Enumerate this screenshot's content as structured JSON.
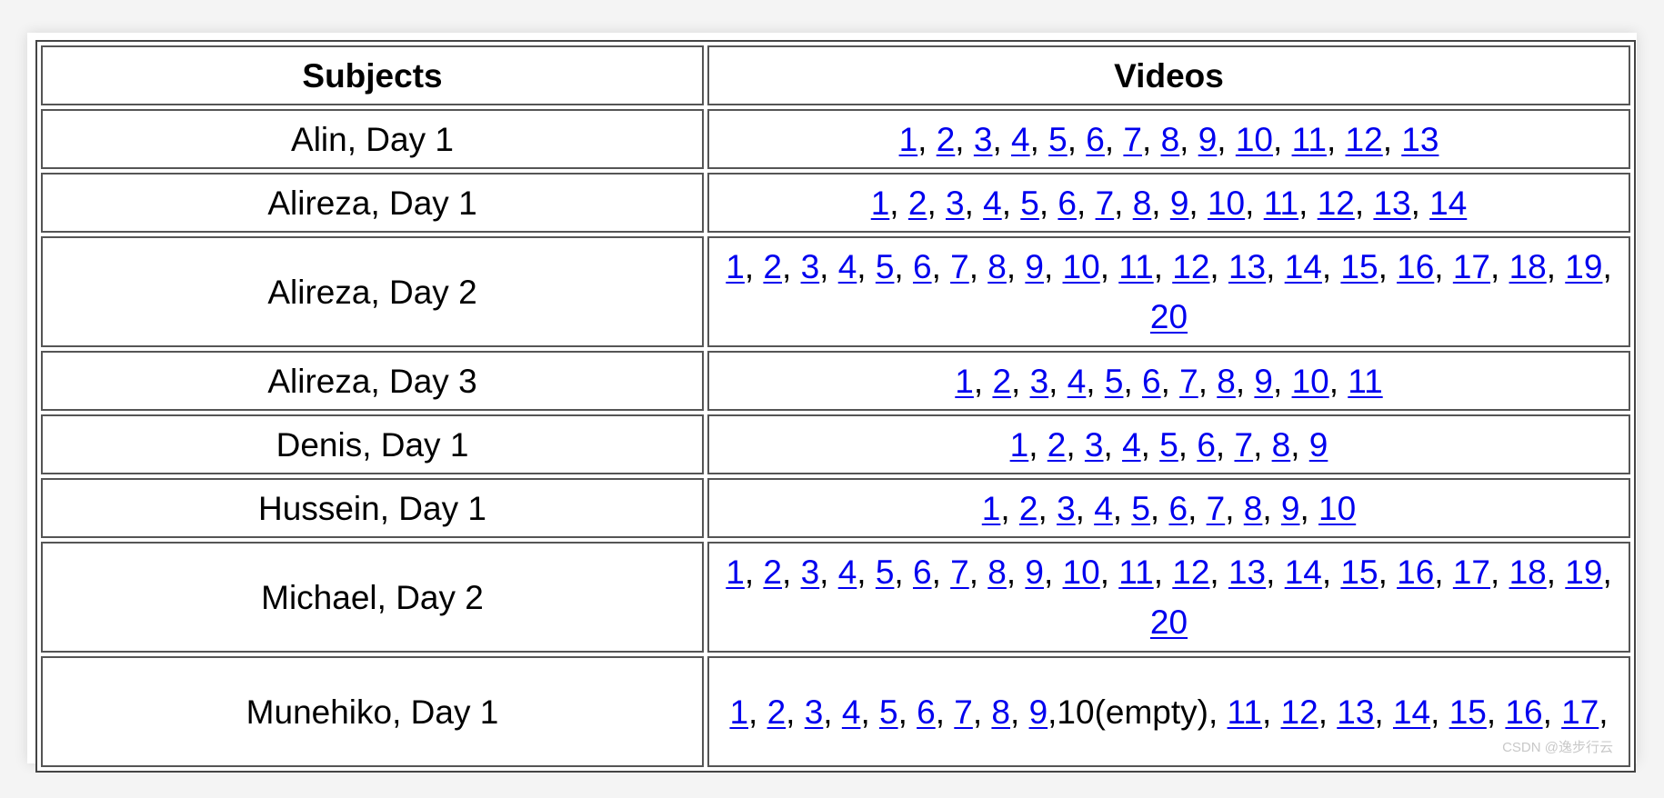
{
  "table": {
    "headers": {
      "subjects": "Subjects",
      "videos": "Videos"
    },
    "rows": [
      {
        "subject": "Alin, Day 1",
        "videos": [
          "1",
          "2",
          "3",
          "4",
          "5",
          "6",
          "7",
          "8",
          "9",
          "10",
          "11",
          "12",
          "13"
        ]
      },
      {
        "subject": "Alireza, Day 1",
        "videos": [
          "1",
          "2",
          "3",
          "4",
          "5",
          "6",
          "7",
          "8",
          "9",
          "10",
          "11",
          "12",
          "13",
          "14"
        ]
      },
      {
        "subject": "Alireza, Day 2",
        "videos": [
          "1",
          "2",
          "3",
          "4",
          "5",
          "6",
          "7",
          "8",
          "9",
          "10",
          "11",
          "12",
          "13",
          "14",
          "15",
          "16",
          "17",
          "18",
          "19",
          "20"
        ]
      },
      {
        "subject": "Alireza, Day 3",
        "videos": [
          "1",
          "2",
          "3",
          "4",
          "5",
          "6",
          "7",
          "8",
          "9",
          "10",
          "11"
        ]
      },
      {
        "subject": "Denis, Day 1",
        "videos": [
          "1",
          "2",
          "3",
          "4",
          "5",
          "6",
          "7",
          "8",
          "9"
        ]
      },
      {
        "subject": "Hussein, Day 1",
        "videos": [
          "1",
          "2",
          "3",
          "4",
          "5",
          "6",
          "7",
          "8",
          "9",
          "10"
        ]
      },
      {
        "subject": "Michael, Day 2",
        "videos": [
          "1",
          "2",
          "3",
          "4",
          "5",
          "6",
          "7",
          "8",
          "9",
          "10",
          "11",
          "12",
          "13",
          "14",
          "15",
          "16",
          "17",
          "18",
          "19",
          "20"
        ]
      },
      {
        "subject": "Munehiko, Day 1",
        "videos": [
          "1",
          "2",
          "3",
          "4",
          "5",
          "6",
          "7",
          "8",
          "9",
          "10(empty)",
          "11",
          "12",
          "13",
          "14",
          "15",
          "16",
          "17"
        ],
        "unlinked": [
          "10(empty)"
        ],
        "trailing_comma": true
      }
    ]
  },
  "watermark": "CSDN @逸步行云"
}
